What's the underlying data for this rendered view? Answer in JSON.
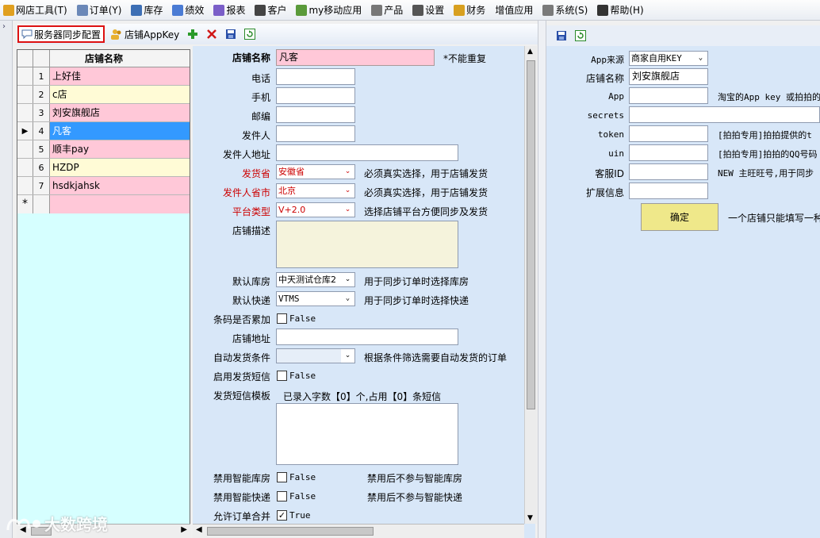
{
  "menubar": {
    "items": [
      {
        "label": "网店工具(T)",
        "icon": "shop-tool-icon",
        "color": "#e0a020"
      },
      {
        "label": "订单(Y)",
        "icon": "order-doc-icon",
        "color": "#6b88b8"
      },
      {
        "label": "库存",
        "icon": "inventory-icon",
        "color": "#3d6fb5"
      },
      {
        "label": "绩效",
        "icon": "performance-icon",
        "color": "#4a7bd4"
      },
      {
        "label": "报表",
        "icon": "report-icon",
        "color": "#7a5ec8"
      },
      {
        "label": "客户",
        "icon": "customer-icon",
        "color": "#444444"
      },
      {
        "label": "my移动应用",
        "icon": "mobile-app-icon",
        "color": "#5a9a3a"
      },
      {
        "label": "产品",
        "icon": "product-icon",
        "color": "#777777"
      },
      {
        "label": "设置",
        "icon": "gear-icon",
        "color": "#555555"
      },
      {
        "label": "财务",
        "icon": "finance-icon",
        "color": "#d8a020"
      },
      {
        "label": "增值应用",
        "icon": "",
        "color": ""
      },
      {
        "label": "系统(S)",
        "icon": "system-icon",
        "color": "#7a7a7a"
      },
      {
        "label": "帮助(H)",
        "icon": "help-icon",
        "color": "#333333"
      }
    ]
  },
  "toolbar": {
    "sync_config_label": "服务器同步配置",
    "appkey_label": "店铺AppKey"
  },
  "grid": {
    "header": "店铺名称",
    "rows": [
      {
        "num": "1",
        "name": "上好佳",
        "bg": "#ffc8d8"
      },
      {
        "num": "2",
        "name": "c店",
        "bg": "#fffbd6"
      },
      {
        "num": "3",
        "name": "刘安旗舰店",
        "bg": "#ffc8d8"
      },
      {
        "num": "4",
        "name": "凡客",
        "bg": "#3399ff"
      },
      {
        "num": "5",
        "name": "顺丰pay",
        "bg": "#ffc8d8"
      },
      {
        "num": "6",
        "name": "HZDP",
        "bg": "#fffbd6"
      },
      {
        "num": "7",
        "name": "hsdkjahsk",
        "bg": "#ffc8d8"
      }
    ],
    "new_row_marker": "*",
    "current_row_marker": "▶"
  },
  "form": {
    "shop_name_label": "店铺名称",
    "shop_name_value": "凡客",
    "shop_name_hint": "*不能重复",
    "phone_label": "电话",
    "mobile_label": "手机",
    "postcode_label": "邮编",
    "sender_label": "发件人",
    "sender_address_label": "发件人地址",
    "province_label": "发货省",
    "province_value": "安徽省",
    "province_hint": "必须真实选择，用于店铺发货",
    "sender_city_label": "发件人省市",
    "sender_city_value": "北京",
    "sender_city_hint": "必须真实选择，用于店铺发货",
    "platform_label": "平台类型",
    "platform_value": "V+2.0",
    "platform_hint": "选择店铺平台方便同步及发货",
    "desc_label": "店铺描述",
    "warehouse_label": "默认库房",
    "warehouse_value": "中天测试仓库2",
    "warehouse_hint": "用于同步订单时选择库房",
    "express_label": "默认快递",
    "express_value": "VTMS",
    "express_hint": "用于同步订单时选择快递",
    "barcode_label": "条码是否累加",
    "barcode_value": "False",
    "shop_address_label": "店铺地址",
    "auto_ship_label": "自动发货条件",
    "auto_ship_hint": "根据条件筛选需要自动发货的订单",
    "ship_sms_label": "启用发货短信",
    "ship_sms_value": "False",
    "sms_template_label": "发货短信模板",
    "sms_count_text": "已录入字数【0】个,占用【0】条短信",
    "smart_warehouse_label": "禁用智能库房",
    "smart_warehouse_value": "False",
    "smart_warehouse_hint": "禁用后不参与智能库房",
    "smart_express_label": "禁用智能快递",
    "smart_express_value": "False",
    "smart_express_hint": "禁用后不参与智能快递",
    "merge_label": "允许订单合并",
    "merge_value": "True"
  },
  "right": {
    "app_source_label": "App来源",
    "app_source_value": "商家自用KEY",
    "shop_name_label": "店铺名称",
    "shop_name_value": "刘安旗舰店",
    "app_label": "App",
    "app_hint": "淘宝的App key 或拍拍的",
    "secrets_label": "secrets",
    "token_label": "token",
    "token_hint": "[拍拍专用]拍拍提供的t",
    "uin_label": "uin",
    "uin_hint": "[拍拍专用]拍拍的QQ号码",
    "service_id_label": "客服ID",
    "service_id_hint": "NEW 主旺旺号,用于同步",
    "ext_label": "扩展信息",
    "ok_label": "确定",
    "note": "一个店铺只能填写一种"
  },
  "watermark": "大数跨境",
  "colors": {
    "form_bg": "#d8e7f8",
    "grid_bg": "#d6ffff",
    "pink_row": "#ffc8d8",
    "yellow_row": "#fffbd6",
    "selected_row": "#3399ff",
    "required_label": "#cc0000",
    "textarea_bg": "#f5f3dc",
    "ok_button": "#efe88a"
  }
}
